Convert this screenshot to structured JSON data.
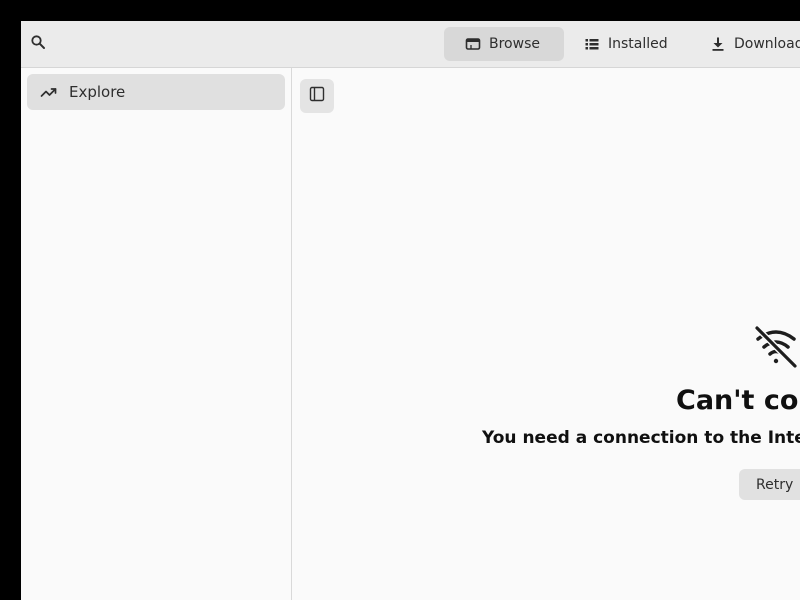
{
  "header": {
    "search_icon": "search-icon",
    "tabs": [
      {
        "label": "Browse",
        "icon": "browse-window-icon",
        "active": true
      },
      {
        "label": "Installed",
        "icon": "list-icon",
        "active": false
      },
      {
        "label": "Downloads",
        "icon": "download-icon",
        "active": false
      }
    ]
  },
  "sidebar": {
    "items": [
      {
        "label": "Explore",
        "icon": "trending-up-icon",
        "selected": true
      }
    ]
  },
  "content": {
    "toggle_icon": "sidebar-toggle-icon",
    "status": {
      "icon": "wifi-off-icon",
      "title": "Can't connect",
      "description": "You need a connection to the Internet",
      "retry_label": "Retry"
    }
  },
  "colors": {
    "headerbar": "#ebebeb",
    "content_bg": "#fafafa",
    "selected_bg": "#e0e0e0",
    "text": "#2e2e2e"
  }
}
